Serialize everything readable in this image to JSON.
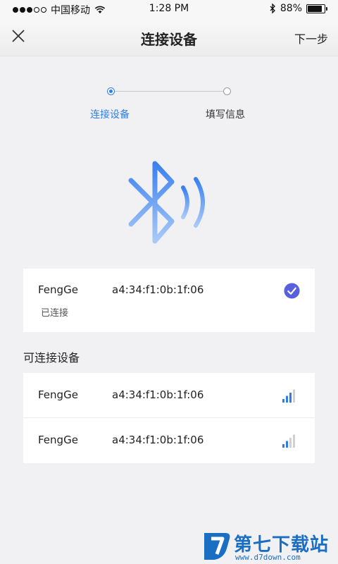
{
  "status_bar": {
    "carrier": "中国移动",
    "time": "1:28 PM",
    "battery": "88%",
    "battery_level": 0.88
  },
  "nav": {
    "title": "连接设备",
    "next_label": "下一步",
    "close_icon": "close-icon"
  },
  "stepper": {
    "steps": [
      {
        "label": "连接设备",
        "active": true
      },
      {
        "label": "填写信息",
        "active": false
      }
    ]
  },
  "illustration": {
    "icon": "bluetooth-icon",
    "color": "#4e8ef0"
  },
  "connected": {
    "name": "FengGe",
    "mac": "a4:34:f1:0b:1f:06",
    "status": "已连接",
    "icon": "check-circle-icon",
    "accent": "#5860de"
  },
  "available": {
    "title": "可连接设备",
    "devices": [
      {
        "name": "FengGe",
        "mac": "a4:34:f1:0b:1f:06",
        "signal_level": 3,
        "signal_max": 4
      },
      {
        "name": "FengGe",
        "mac": "a4:34:f1:0b:1f:06",
        "signal_level": 2,
        "signal_max": 4
      }
    ]
  },
  "watermark": {
    "text": "第七下载站",
    "url": "www.d7down.com"
  },
  "colors": {
    "accent_blue": "#2d7ee8",
    "background": "#f1f1f4"
  }
}
